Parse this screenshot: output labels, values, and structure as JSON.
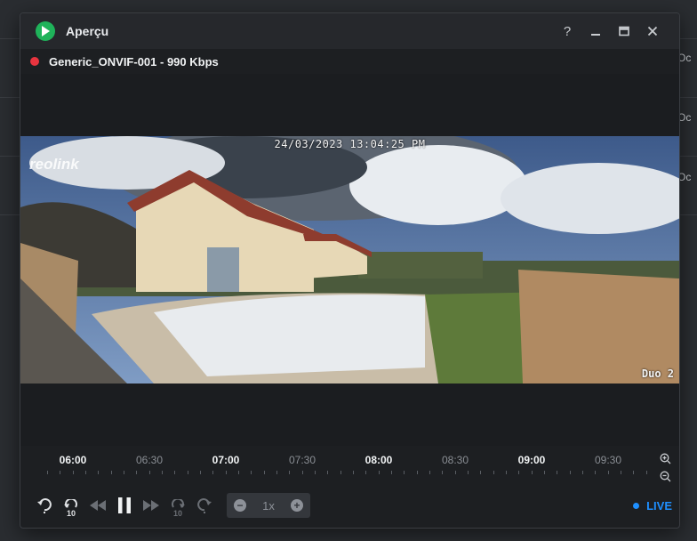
{
  "background": {
    "cells": [
      "Oc",
      "Oc",
      "Oc"
    ]
  },
  "window": {
    "title": "Aperçu",
    "icon": "play-icon",
    "buttons": [
      "help-icon",
      "minimize-icon",
      "maximize-icon",
      "close-icon"
    ],
    "help_label": "?"
  },
  "stream": {
    "label": "Generic_ONVIF-001 - 990 Kbps",
    "status_color": "#e8343f"
  },
  "video": {
    "timestamp": "24/03/2023 13:04:25 PM",
    "brand": "reolink",
    "model": "Duo 2"
  },
  "timeline": {
    "labels": [
      "06:00",
      "06:30",
      "07:00",
      "07:30",
      "08:00",
      "08:30",
      "09:00",
      "09:30"
    ]
  },
  "controls": {
    "speed": "1x",
    "skip_label": "10",
    "live_label": "LIVE",
    "live_color": "#1e8fff"
  }
}
